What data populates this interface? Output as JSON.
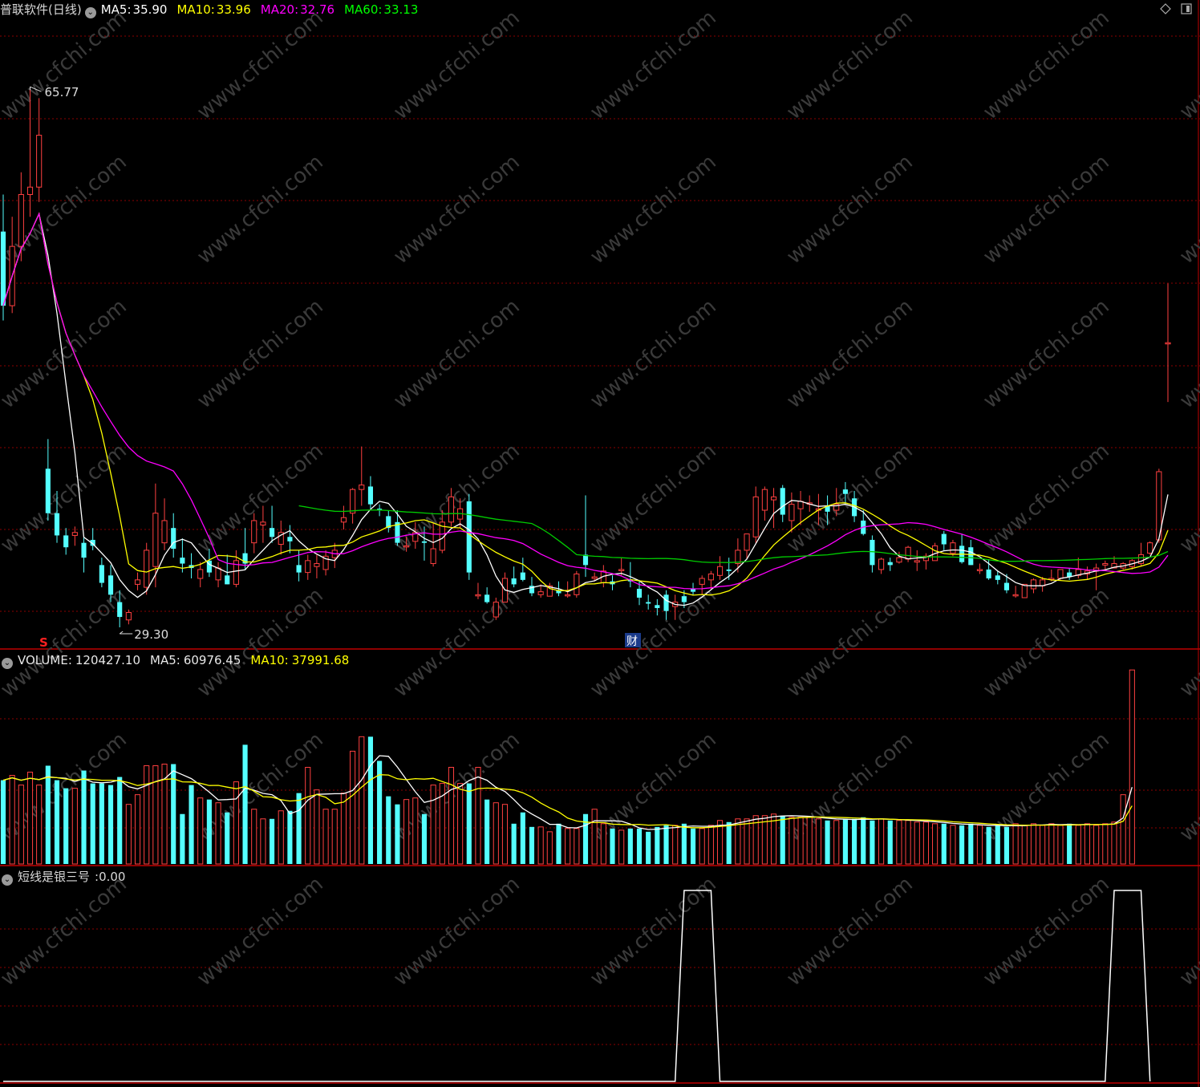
{
  "title": "普联软件(日线)",
  "main": {
    "indicators": [
      {
        "label": "MA5:",
        "value": "35.90",
        "color": "#ffffff"
      },
      {
        "label": "MA10:",
        "value": "33.96",
        "color": "#ffff00"
      },
      {
        "label": "MA20:",
        "value": "32.76",
        "color": "#ff00ff"
      },
      {
        "label": "MA60:",
        "value": "33.13",
        "color": "#00ff00"
      }
    ],
    "high_label": "65.77",
    "low_label": "29.30",
    "marker_s": "S",
    "marker_cai": "财"
  },
  "volume": {
    "label": "VOLUME:",
    "value": "120427.10",
    "ma5_label": "MA5:",
    "ma5_value": "60976.45",
    "ma10_label": "MA10:",
    "ma10_value": "37991.68"
  },
  "signal": {
    "label": "短线是银三号",
    "value": ":0.00"
  },
  "watermark": "www.cfchi.com",
  "colors": {
    "up": "#ff4040",
    "down": "#54ffff",
    "ma5": "#ffffff",
    "ma10": "#ffff00",
    "ma20": "#ff00ff",
    "ma60": "#00cc00",
    "grid": "#8b0000"
  },
  "chart_data": [
    {
      "type": "candlestick",
      "name": "price",
      "ylim": [
        28,
        70
      ],
      "notes": "Daily candles; open/high/low/close values estimated from the visual.",
      "candles": [
        [
          56,
          58.5,
          50,
          51
        ],
        [
          51,
          57,
          50.5,
          55
        ],
        [
          55,
          60,
          54,
          58.5
        ],
        [
          58.5,
          65.77,
          57,
          59
        ],
        [
          59,
          65,
          58,
          62.5
        ],
        [
          40,
          42,
          36.5,
          37
        ],
        [
          37,
          38.5,
          35,
          35.5
        ],
        [
          35.5,
          36,
          34.2,
          34.7
        ],
        [
          35.5,
          36.1,
          34.8,
          35.7
        ],
        [
          35,
          35.4,
          33,
          34
        ],
        [
          35.2,
          36,
          34.5,
          34.8
        ],
        [
          33.5,
          34,
          32,
          32.3
        ],
        [
          32.8,
          33.5,
          31,
          31.5
        ],
        [
          31,
          31.8,
          29.3,
          30
        ],
        [
          29.8,
          30.5,
          29.5,
          30.3
        ],
        [
          32.2,
          33,
          31.8,
          32.5
        ],
        [
          32,
          35,
          31.5,
          34.5
        ],
        [
          33.4,
          39,
          32,
          37
        ],
        [
          35,
          38,
          34.5,
          36.5
        ],
        [
          36,
          37,
          34,
          34.6
        ],
        [
          34,
          35.3,
          33,
          33.6
        ],
        [
          33.5,
          34.3,
          32.6,
          33.3
        ],
        [
          32.6,
          33.7,
          32,
          33.2
        ],
        [
          33.8,
          34.6,
          32.7,
          33
        ],
        [
          32.5,
          33.7,
          32,
          33.3
        ],
        [
          32.8,
          34.2,
          32.2,
          32.2
        ],
        [
          32.2,
          34.5,
          32,
          33.8
        ],
        [
          34.3,
          36,
          33.2,
          33.6
        ],
        [
          35,
          37,
          34.3,
          36.5
        ],
        [
          36.2,
          37.5,
          35,
          36.4
        ],
        [
          36,
          37.5,
          35,
          35.4
        ],
        [
          34.9,
          36.5,
          34.2,
          35.7
        ],
        [
          35.4,
          36.2,
          34.3,
          35.1
        ],
        [
          33.5,
          34.5,
          32.4,
          33
        ],
        [
          33,
          34.2,
          32.5,
          33.8
        ],
        [
          33.4,
          34.2,
          32.6,
          33.6
        ],
        [
          33.2,
          34.5,
          32.8,
          34.1
        ],
        [
          34,
          35,
          33.3,
          34.5
        ],
        [
          36.4,
          37.5,
          35.9,
          36.7
        ],
        [
          37,
          38.7,
          36.3,
          38.6
        ],
        [
          38.6,
          41.5,
          37.5,
          38.9
        ],
        [
          38.8,
          39.5,
          37.3,
          37.6
        ],
        [
          37.3,
          37.6,
          36.8,
          37.2
        ],
        [
          36.8,
          37.2,
          35.7,
          36
        ],
        [
          36.4,
          37.2,
          34.8,
          35
        ],
        [
          34.8,
          35.4,
          34.4,
          34.8
        ],
        [
          35.1,
          36.4,
          34.6,
          35.7
        ],
        [
          35.1,
          36.1,
          33.8,
          35
        ],
        [
          33.6,
          36.3,
          33.4,
          34.6
        ],
        [
          34.5,
          37.2,
          34.3,
          36.4
        ],
        [
          36.4,
          38.7,
          36.1,
          38.1
        ],
        [
          36.6,
          38,
          36,
          37.3
        ],
        [
          37.8,
          38.3,
          32.5,
          33
        ],
        [
          31.5,
          32.3,
          31.2,
          31.5
        ],
        [
          31.5,
          32,
          30.9,
          31
        ],
        [
          30,
          31.3,
          29.8,
          31
        ],
        [
          31,
          33,
          31,
          32.6
        ],
        [
          32.6,
          33.4,
          32,
          32.2
        ],
        [
          33,
          34,
          32.4,
          32.5
        ],
        [
          32.1,
          32.7,
          31.4,
          31.6
        ],
        [
          31.5,
          32.2,
          31.3,
          31.7
        ],
        [
          31.4,
          32.3,
          31.4,
          32.1
        ],
        [
          31.8,
          32.4,
          31.4,
          31.6
        ],
        [
          31.5,
          32.4,
          31.3,
          31.5
        ],
        [
          31.5,
          33.1,
          31.3,
          32.9
        ],
        [
          34.2,
          38.2,
          32.7,
          33.5
        ],
        [
          32.6,
          33,
          32.4,
          32.7
        ],
        [
          32.3,
          33.5,
          32,
          33.1
        ],
        [
          32.4,
          32.8,
          31.8,
          32.2
        ],
        [
          33.2,
          34,
          32.8,
          33.2
        ],
        [
          32.5,
          33.7,
          32,
          32.4
        ],
        [
          31.9,
          32.5,
          30.8,
          31.3
        ],
        [
          31,
          31.5,
          30.5,
          30.9
        ],
        [
          30.8,
          31.2,
          30.1,
          30.6
        ],
        [
          31.5,
          31.8,
          29.8,
          30.4
        ],
        [
          30.7,
          31.5,
          29.8,
          31
        ],
        [
          31.4,
          31.8,
          30.6,
          31
        ],
        [
          31.9,
          32.3,
          31.5,
          31.7
        ],
        [
          32.2,
          32.8,
          31.5,
          32.6
        ],
        [
          32.5,
          33.1,
          31.9,
          32.9
        ],
        [
          32.8,
          34.1,
          32.5,
          33.4
        ],
        [
          33.2,
          34,
          32.5,
          33.1
        ],
        [
          33.6,
          35.3,
          33,
          34.5
        ],
        [
          34.5,
          35.6,
          33.9,
          35.6
        ],
        [
          35.4,
          38.8,
          35,
          38.1
        ],
        [
          37.2,
          38.8,
          36.5,
          38.6
        ],
        [
          37.9,
          38.7,
          36,
          38.1
        ],
        [
          38.7,
          38.9,
          36.4,
          36.9
        ],
        [
          36.5,
          38.4,
          35.7,
          37.6
        ],
        [
          37.3,
          38.5,
          36.2,
          37.8
        ],
        [
          37.6,
          38.2,
          37.1,
          37.7
        ],
        [
          37.2,
          38.3,
          36.2,
          37.3
        ],
        [
          37.5,
          38.2,
          36.2,
          37.1
        ],
        [
          37.2,
          38.7,
          36.8,
          37.6
        ],
        [
          38.6,
          39.1,
          37.6,
          38.3
        ],
        [
          38,
          38.5,
          36.4,
          36.8
        ],
        [
          36.5,
          37.2,
          35.5,
          35.6
        ],
        [
          35.2,
          35.5,
          33,
          33.5
        ],
        [
          33.2,
          34,
          32.9,
          33.9
        ],
        [
          33.7,
          34,
          33.1,
          33.5
        ],
        [
          33.7,
          34.4,
          33.6,
          34
        ],
        [
          33.9,
          34.8,
          33.7,
          34.7
        ],
        [
          33.7,
          34.5,
          33.1,
          33.8
        ],
        [
          33.8,
          34.3,
          33.2,
          34.1
        ],
        [
          33.8,
          35,
          33.8,
          34.8
        ],
        [
          35.6,
          35.8,
          34.5,
          34.9
        ],
        [
          34.3,
          35.2,
          34.1,
          35
        ],
        [
          34.8,
          35.6,
          33.6,
          33.7
        ],
        [
          34.7,
          35.2,
          33.5,
          33.5
        ],
        [
          33.2,
          33.6,
          32.9,
          33.2
        ],
        [
          33.2,
          33.9,
          32.5,
          32.6
        ],
        [
          32.8,
          33.1,
          32.2,
          32.5
        ],
        [
          32.3,
          32.9,
          31.6,
          31.8
        ],
        [
          31.5,
          32.1,
          31.3,
          31.5
        ],
        [
          31.3,
          32.2,
          31.3,
          32.2
        ],
        [
          31.9,
          32.6,
          31.6,
          32.5
        ],
        [
          32.1,
          32.7,
          31.7,
          32.5
        ],
        [
          32.6,
          33.2,
          32.4,
          32.6
        ],
        [
          32.6,
          33.2,
          32.5,
          33.2
        ],
        [
          33,
          33.3,
          32.5,
          32.7
        ],
        [
          32.8,
          34,
          32.6,
          33.2
        ],
        [
          32.9,
          33.4,
          32.5,
          33.1
        ],
        [
          33.1,
          33.6,
          31.8,
          33.3
        ],
        [
          33.5,
          33.8,
          33.1,
          33.6
        ],
        [
          33.3,
          34.1,
          33.3,
          33.6
        ],
        [
          33.3,
          33.7,
          33.2,
          33.6
        ],
        [
          33.4,
          33.9,
          33.2,
          33.8
        ],
        [
          33.6,
          35,
          33.4,
          34.2
        ],
        [
          34.3,
          35.1,
          34.2,
          35
        ],
        [
          35.2,
          40,
          35,
          39.8
        ],
        [
          48.5,
          52.5,
          44.5,
          48.5
        ]
      ],
      "series": [
        {
          "name": "MA5",
          "value": 35.9
        },
        {
          "name": "MA10",
          "value": 33.96
        },
        {
          "name": "MA20",
          "value": 32.76
        },
        {
          "name": "MA60",
          "value": 33.13
        }
      ],
      "annotations": [
        "65.77",
        "29.30",
        "S",
        "财"
      ]
    },
    {
      "type": "bar",
      "name": "volume",
      "ylim": [
        0,
        120000
      ],
      "values": [
        52000,
        55000,
        49000,
        57000,
        49000,
        61000,
        52000,
        47000,
        47000,
        58000,
        50000,
        50000,
        49000,
        54000,
        37000,
        43000,
        61000,
        61000,
        62000,
        62000,
        31000,
        49000,
        41000,
        40000,
        38000,
        32000,
        51000,
        74000,
        34000,
        28000,
        28000,
        33000,
        33000,
        44000,
        60000,
        46000,
        34000,
        34000,
        44000,
        70000,
        79000,
        79000,
        64000,
        42000,
        37000,
        40000,
        41000,
        31000,
        49000,
        50000,
        60000,
        50000,
        50000,
        60000,
        40000,
        38000,
        37000,
        25000,
        32000,
        23000,
        23000,
        20000,
        25000,
        22000,
        22000,
        31000,
        34000,
        25000,
        22000,
        21000,
        22000,
        22000,
        20000,
        23000,
        24000,
        24000,
        25000,
        22000,
        22000,
        24000,
        27000,
        26000,
        28000,
        28000,
        30000,
        30000,
        31000,
        30000,
        29000,
        29000,
        29000,
        28000,
        27000,
        27000,
        28000,
        28000,
        29000,
        27000,
        28000,
        27000,
        27000,
        27000,
        26000,
        26000,
        25000,
        25000,
        24000,
        24000,
        25000,
        24000,
        23000,
        24000,
        23000,
        25000,
        24000,
        25000,
        24000,
        25000,
        24000,
        25000,
        24000,
        25000,
        24000,
        25000,
        26000,
        43000,
        120427.1
      ],
      "ma5": 60976.45,
      "ma10": 37991.68,
      "title": "VOLUME"
    },
    {
      "type": "line",
      "name": "短线是银三号",
      "ylim": [
        0,
        1
      ],
      "values": [
        0,
        0,
        0,
        0,
        0,
        0,
        0,
        0,
        0,
        0,
        0,
        0,
        0,
        0,
        0,
        0,
        0,
        0,
        0,
        0,
        0,
        0,
        0,
        0,
        0,
        0,
        0,
        0,
        0,
        0,
        0,
        0,
        0,
        0,
        0,
        0,
        0,
        0,
        0,
        0,
        0,
        0,
        0,
        0,
        0,
        0,
        0,
        0,
        0,
        0,
        0,
        0,
        0,
        0,
        0,
        0,
        0,
        0,
        0,
        0,
        0,
        0,
        0,
        0,
        0,
        0,
        0,
        0,
        0,
        0,
        0,
        0,
        0,
        0,
        0,
        0,
        0,
        0,
        0,
        0,
        0,
        0,
        0,
        0,
        0,
        0,
        0,
        0,
        0,
        0,
        0,
        0,
        0,
        0,
        0,
        0,
        0,
        0,
        0,
        0,
        0,
        0,
        0,
        0,
        0,
        0,
        0,
        0,
        0,
        0,
        0,
        0,
        0,
        0,
        0,
        0,
        0,
        0,
        0,
        0,
        0,
        0,
        0,
        0,
        0,
        0,
        0,
        0,
        0
      ],
      "pulses": [
        [
          76,
          79
        ],
        [
          124,
          127
        ]
      ]
    }
  ]
}
